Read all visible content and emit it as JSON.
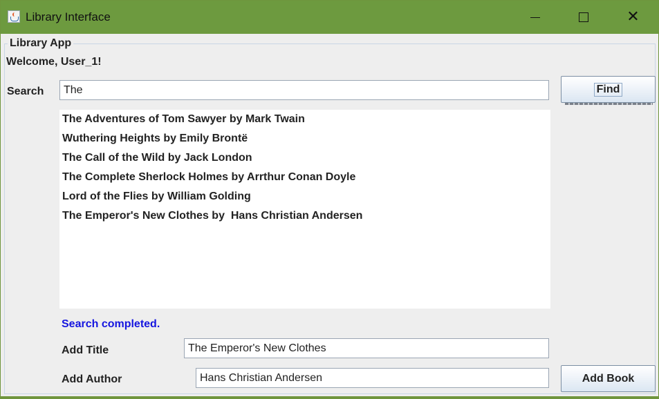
{
  "window": {
    "title": "Library Interface",
    "accent": "#6d9a3f"
  },
  "panel": {
    "legend": "Library App",
    "welcome": "Welcome, User_1!"
  },
  "search": {
    "label": "Search",
    "value": "The",
    "button": "Find"
  },
  "results": [
    "The Adventures of Tom Sawyer by Mark Twain",
    "Wuthering Heights by Emily Brontë",
    "The Call of the Wild by Jack London",
    "The Complete Sherlock Holmes by Arrthur Conan Doyle",
    "Lord of the Flies by William Golding",
    "The Emperor's New Clothes by  Hans Christian Andersen"
  ],
  "status": {
    "text": "Search completed.",
    "color": "#1515e0"
  },
  "add": {
    "title_label": "Add Title",
    "title_value": "The Emperor's New Clothes",
    "author_label": "Add Author",
    "author_value": "Hans Christian Andersen",
    "button": "Add Book"
  },
  "icons": {
    "app": "java-cup-icon",
    "minimize": "minimize-icon",
    "maximize": "maximize-icon",
    "close": "close-icon"
  }
}
